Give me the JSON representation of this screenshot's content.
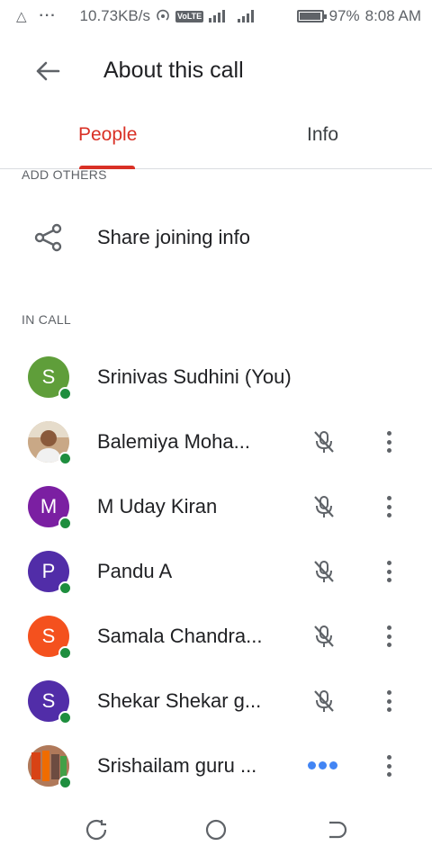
{
  "status_bar": {
    "speed": "10.73KB/s",
    "volte": "VoLTE",
    "lte": "LTE",
    "battery": "97%",
    "time": "8:08 AM",
    "battery_level": 0.97
  },
  "app_bar": {
    "title": "About this call",
    "back_icon": "arrow-back-icon"
  },
  "tabs": [
    {
      "label": "People",
      "active": true
    },
    {
      "label": "Info",
      "active": false
    }
  ],
  "add_others": {
    "label": "ADD OTHERS",
    "share_label": "Share joining info",
    "icon": "share-icon"
  },
  "in_call": {
    "label": "IN CALL",
    "people": [
      {
        "initial": "S",
        "name": "Srinivas Sudhini (You)",
        "avatar_color": "#5f9e3a",
        "mic": "none"
      },
      {
        "initial": "",
        "name": "Balemiya Moha...",
        "avatar_color": "#d9c3a5",
        "mic": "muted",
        "photo": true
      },
      {
        "initial": "M",
        "name": "M Uday Kiran",
        "avatar_color": "#7b1fa2",
        "mic": "muted"
      },
      {
        "initial": "P",
        "name": "Pandu A",
        "avatar_color": "#512da8",
        "mic": "muted"
      },
      {
        "initial": "S",
        "name": "Samala Chandra...",
        "avatar_color": "#f4511e",
        "mic": "muted"
      },
      {
        "initial": "S",
        "name": "Shekar Shekar g...",
        "avatar_color": "#512da8",
        "mic": "muted"
      },
      {
        "initial": "",
        "name": "Srishailam guru ...",
        "avatar_color": "#b0795a",
        "mic": "speaking",
        "photo": true
      }
    ]
  },
  "colors": {
    "accent": "#d93025",
    "online": "#1e8e3e",
    "speaking": "#4285f4"
  },
  "nav": {
    "recent_icon": "recent-apps-icon",
    "home_icon": "home-icon",
    "back_icon": "nav-back-icon"
  }
}
